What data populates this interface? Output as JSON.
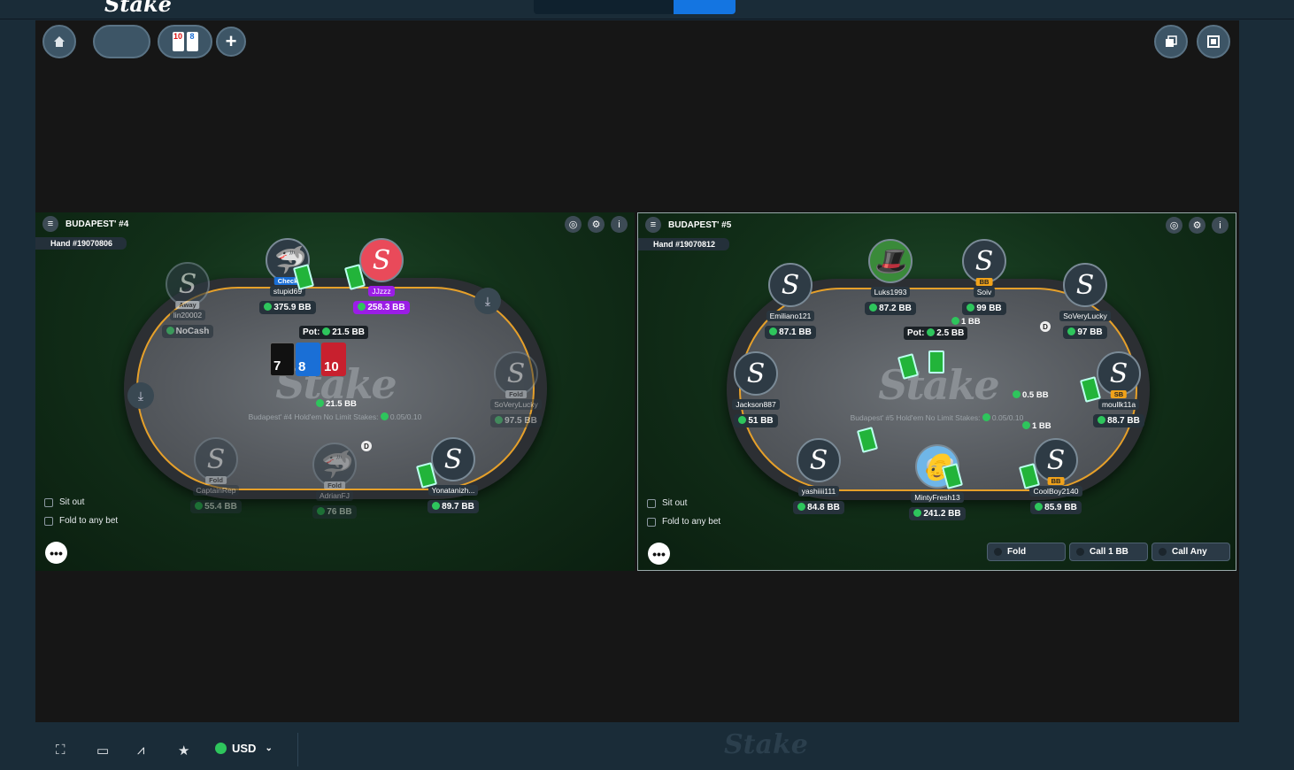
{
  "colors": {
    "accent": "#1475e1",
    "felt_ring": "#e6a02a",
    "chip": "#2ec55c",
    "bg": "#1a2c38"
  },
  "toolbar": {
    "home_icon": "home-icon",
    "add_icon": "plus-icon",
    "tab_cards": [
      "10",
      "8"
    ]
  },
  "tables": [
    {
      "name": "BUDAPEST' #4",
      "hand": "Hand #19070806",
      "stakes_line": "Budapest' #4 Hold'em No Limit Stakes:",
      "stakes_value": "0.05/0.10",
      "pot_label": "Pot:",
      "pot_value": "21.5 BB",
      "center_bet": "21.5 BB",
      "board_cards": [
        "7",
        "8",
        "10"
      ],
      "seats": [
        {
          "name": "stupid69",
          "chips": "375.9 BB",
          "badge": "Check"
        },
        {
          "name": "JJzzz",
          "chips": "258.3 BB",
          "badge": ""
        },
        {
          "name": "lin20002",
          "chips": "NoCash",
          "badge": "Away"
        },
        {
          "name": "SoVeryLucky",
          "chips": "97.5 BB",
          "badge": "Fold"
        },
        {
          "name": "CaptainRep",
          "chips": "55.4 BB",
          "badge": "Fold"
        },
        {
          "name": "AdrianFJ",
          "chips": "76 BB",
          "badge": "Fold"
        },
        {
          "name": "Yonatanizh...",
          "chips": "89.7 BB",
          "badge": ""
        }
      ],
      "dealer": "D",
      "sit_out": "Sit out",
      "fold_any": "Fold to any bet"
    },
    {
      "name": "BUDAPEST' #5",
      "hand": "Hand #19070812",
      "stakes_line": "Budapest' #5 Hold'em No Limit Stakes:",
      "stakes_value": "0.05/0.10",
      "pot_label": "Pot:",
      "pot_value": "2.5 BB",
      "seats": [
        {
          "name": "Emiliano121",
          "chips": "87.1 BB",
          "badge": ""
        },
        {
          "name": "Luks1993",
          "chips": "87.2 BB",
          "badge": ""
        },
        {
          "name": "Soiv",
          "chips": "99 BB",
          "badge": "BB"
        },
        {
          "name": "SoVeryLucky",
          "chips": "97 BB",
          "badge": ""
        },
        {
          "name": "Jackson887",
          "chips": "51 BB",
          "badge": ""
        },
        {
          "name": "moullk11a",
          "chips": "88.7 BB",
          "badge": "SB"
        },
        {
          "name": "yashiiii111",
          "chips": "84.8 BB",
          "badge": ""
        },
        {
          "name": "MintyFresh13",
          "chips": "241.2 BB",
          "badge": ""
        },
        {
          "name": "CoolBoy2140",
          "chips": "85.9 BB",
          "badge": "BB"
        }
      ],
      "bets": [
        "1 BB",
        "0.5 BB",
        "1 BB"
      ],
      "dealer": "D",
      "sit_out": "Sit out",
      "fold_any": "Fold to any bet",
      "actions": [
        "Fold",
        "Call 1 BB",
        "Call Any"
      ]
    }
  ],
  "felt_logo": "Stake",
  "bottom": {
    "currency": "USD",
    "logo": "Stake"
  }
}
